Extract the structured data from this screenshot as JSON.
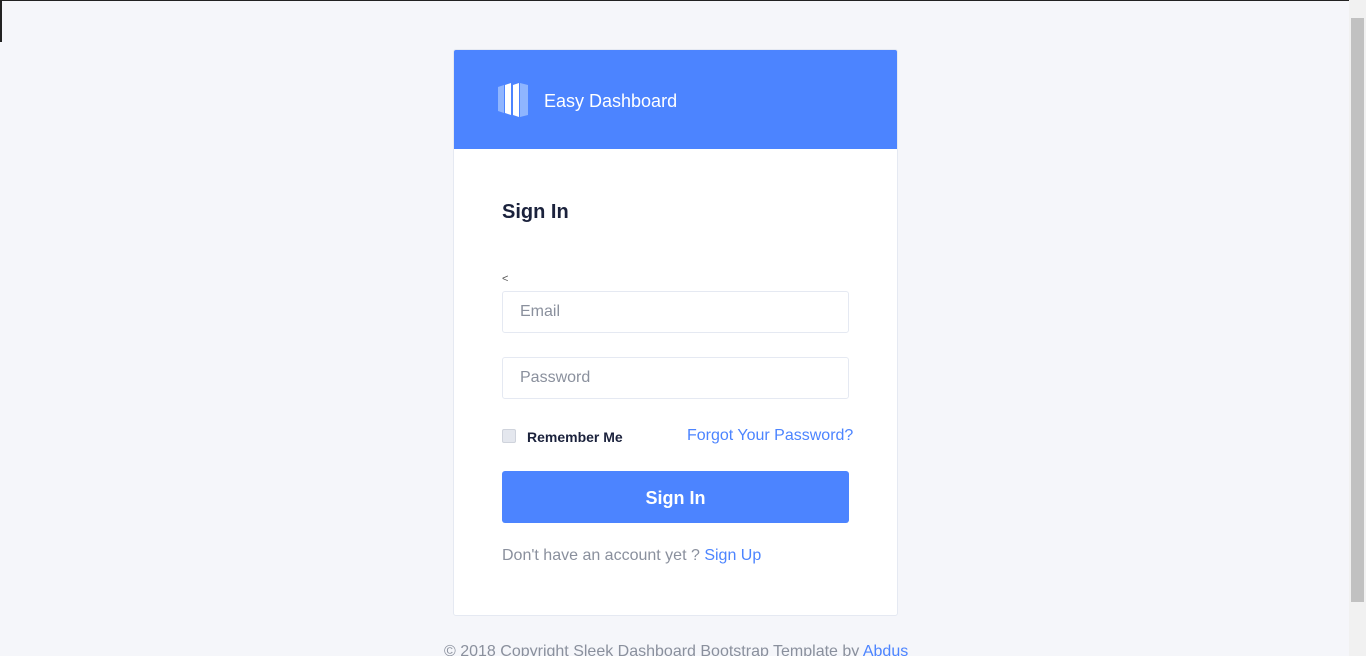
{
  "brand": {
    "name": "Easy Dashboard",
    "icon": "logo-bars-icon",
    "accent_color": "#4c84ff"
  },
  "form": {
    "title": "Sign In",
    "stray_char": "<",
    "email_placeholder": "Email",
    "password_placeholder": "Password",
    "remember_label": "Remember Me",
    "forgot_label": "Forgot Your Password?",
    "submit_label": "Sign In",
    "signup_prompt": "Don't have an account yet ?",
    "signup_link": "Sign Up"
  },
  "footer": {
    "text": "© 2018 Copyright Sleek Dashboard Bootstrap Template by",
    "author": "Abdus"
  }
}
